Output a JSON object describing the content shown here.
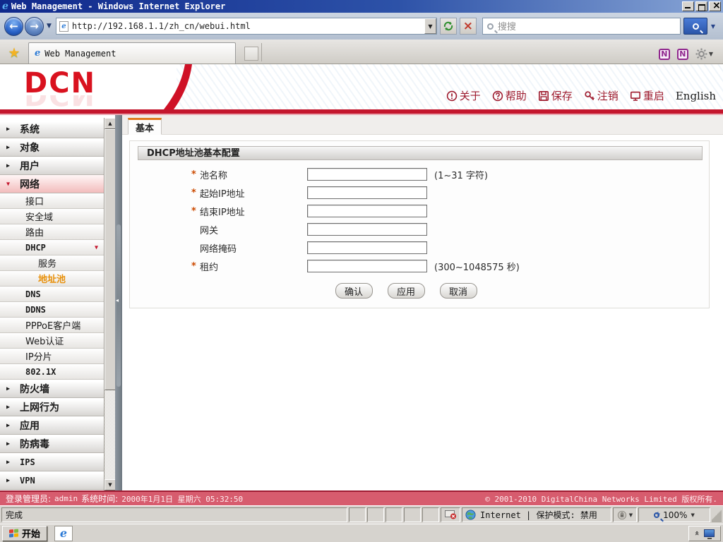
{
  "window": {
    "title": "Web Management - Windows Internet Explorer"
  },
  "browser": {
    "url": "http://192.168.1.1/zh_cn/webui.html",
    "search_placeholder": "搜搜",
    "tab_title": "Web Management"
  },
  "header": {
    "logo": "DCN",
    "links": [
      {
        "id": "about",
        "label": "关于"
      },
      {
        "id": "help",
        "label": "帮助"
      },
      {
        "id": "save",
        "label": "保存"
      },
      {
        "id": "logout",
        "label": "注销"
      },
      {
        "id": "reboot",
        "label": "重启"
      },
      {
        "id": "english",
        "label": "English"
      }
    ]
  },
  "sidebar": {
    "items": [
      {
        "id": "system",
        "label": "系统",
        "level": 1
      },
      {
        "id": "object",
        "label": "对象",
        "level": 1
      },
      {
        "id": "user",
        "label": "用户",
        "level": 1
      },
      {
        "id": "network",
        "label": "网络",
        "level": 1,
        "expanded": true
      },
      {
        "id": "interface",
        "label": "接口",
        "level": 2
      },
      {
        "id": "zone",
        "label": "安全域",
        "level": 2
      },
      {
        "id": "route",
        "label": "路由",
        "level": 2
      },
      {
        "id": "dhcp",
        "label": "DHCP",
        "level": 2,
        "trailing_arrow": true
      },
      {
        "id": "service",
        "label": "服务",
        "level": 3
      },
      {
        "id": "pool",
        "label": "地址池",
        "level": 3,
        "active": true
      },
      {
        "id": "dns",
        "label": "DNS",
        "level": 2
      },
      {
        "id": "ddns",
        "label": "DDNS",
        "level": 2
      },
      {
        "id": "pppoe",
        "label": "PPPoE客户端",
        "level": 2
      },
      {
        "id": "webauth",
        "label": "Web认证",
        "level": 2
      },
      {
        "id": "ipfrag",
        "label": "IP分片",
        "level": 2
      },
      {
        "id": "dot1x",
        "label": "802.1X",
        "level": 2
      },
      {
        "id": "firewall",
        "label": "防火墙",
        "level": 1
      },
      {
        "id": "behavior",
        "label": "上网行为",
        "level": 1
      },
      {
        "id": "app",
        "label": "应用",
        "level": 1
      },
      {
        "id": "antivirus",
        "label": "防病毒",
        "level": 1
      },
      {
        "id": "ips",
        "label": "IPS",
        "level": 1
      },
      {
        "id": "vpn",
        "label": "VPN",
        "level": 1
      }
    ]
  },
  "main": {
    "tab_label": "基本",
    "section_title": "DHCP地址池基本配置",
    "fields": [
      {
        "id": "pool-name",
        "label": "池名称",
        "required": true,
        "value": "",
        "hint": "(1~31 字符)"
      },
      {
        "id": "start-ip",
        "label": "起始IP地址",
        "required": true,
        "value": "",
        "hint": ""
      },
      {
        "id": "end-ip",
        "label": "结束IP地址",
        "required": true,
        "value": "",
        "hint": ""
      },
      {
        "id": "gateway",
        "label": "网关",
        "required": false,
        "value": "",
        "hint": ""
      },
      {
        "id": "netmask",
        "label": "网络掩码",
        "required": false,
        "value": "",
        "hint": ""
      },
      {
        "id": "lease",
        "label": "租约",
        "required": true,
        "value": "",
        "hint": "(300~1048575 秒)"
      }
    ],
    "buttons": [
      {
        "id": "confirm",
        "label": "确认"
      },
      {
        "id": "apply",
        "label": "应用"
      },
      {
        "id": "cancel",
        "label": "取消"
      }
    ]
  },
  "footer": {
    "login_label": "登录管理员:",
    "admin": "admin",
    "time_label": "系统时间:",
    "time": "2000年1月1日 星期六 05:32:50",
    "copyright": "© 2001-2010 DigitalChina Networks Limited 版权所有."
  },
  "statusbar": {
    "status": "完成",
    "zone": "Internet | 保护模式: 禁用",
    "zoom": "100%"
  },
  "taskbar": {
    "start_label": "开始"
  }
}
